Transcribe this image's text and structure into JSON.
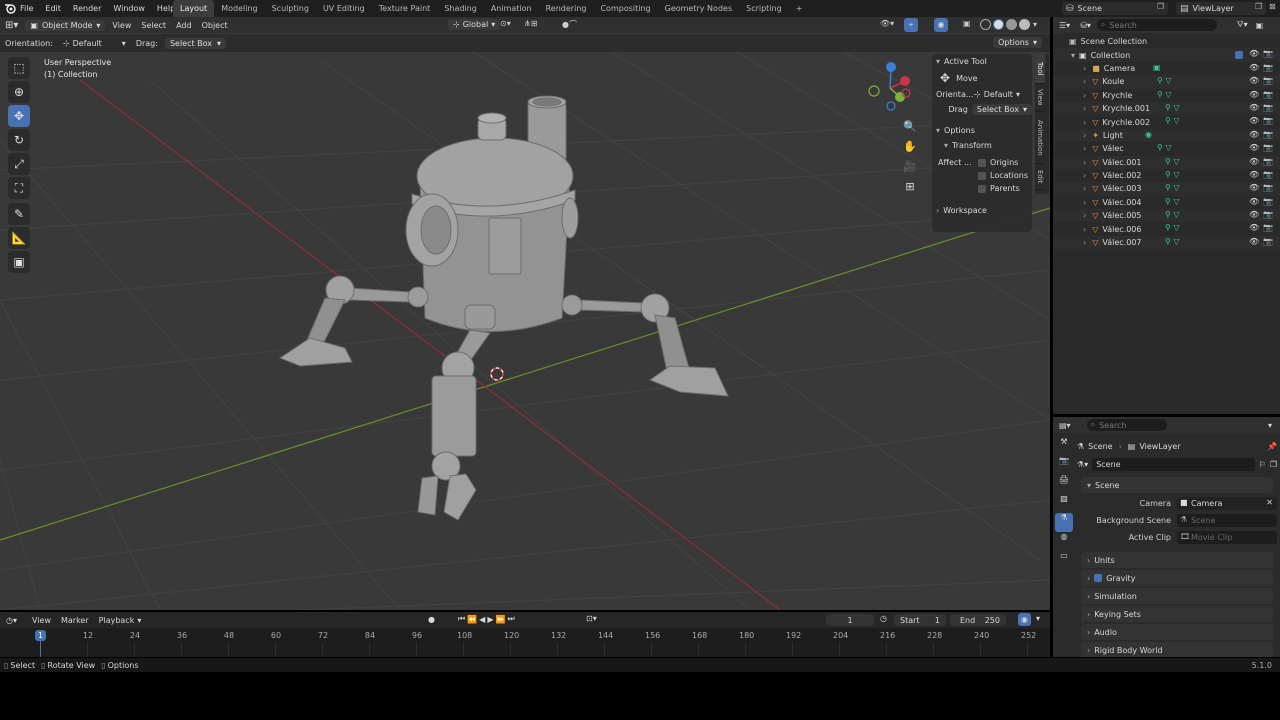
{
  "topbar": {
    "menus": [
      "File",
      "Edit",
      "Render",
      "Window",
      "Help"
    ],
    "workspaces": [
      "Layout",
      "Modeling",
      "Sculpting",
      "UV Editing",
      "Texture Paint",
      "Shading",
      "Animation",
      "Rendering",
      "Compositing",
      "Geometry Nodes",
      "Scripting"
    ],
    "active_workspace": "Layout",
    "add_tab": "+",
    "scene": "Scene",
    "view_layer": "ViewLayer"
  },
  "viewport": {
    "mode": "Object Mode",
    "menus": [
      "View",
      "Select",
      "Add",
      "Object"
    ],
    "transform_orientation": "Global",
    "orientation_label": "Orientation:",
    "orientation_value": "Default",
    "drag_label": "Drag:",
    "drag_value": "Select Box",
    "options": "Options",
    "perspective": "User Perspective",
    "collection_info": "(1) Collection"
  },
  "npanel": {
    "active_tool_title": "Active Tool",
    "tool_name": "Move",
    "orientation_label": "Orienta...",
    "orientation_value": "Default",
    "drag_label": "Drag",
    "drag_value": "Select Box",
    "options_title": "Options",
    "transform_title": "Transform",
    "affect_label": "Affect ...",
    "affect_options": [
      "Origins",
      "Locations",
      "Parents"
    ],
    "workspace_title": "Workspace",
    "tabs": [
      "Tool",
      "View",
      "Animation",
      "Edit"
    ]
  },
  "outliner": {
    "search_placeholder": "Search",
    "scene_collection": "Scene Collection",
    "collection": "Collection",
    "items": [
      {
        "name": "Camera",
        "icon": "camera-icon",
        "color": "#d6a35a"
      },
      {
        "name": "Koule",
        "icon": "mesh-icon",
        "color": "#e8943a"
      },
      {
        "name": "Krychle",
        "icon": "mesh-icon",
        "color": "#e8943a"
      },
      {
        "name": "Krychle.001",
        "icon": "mesh-icon",
        "color": "#e8943a"
      },
      {
        "name": "Krychle.002",
        "icon": "mesh-icon",
        "color": "#e8943a"
      },
      {
        "name": "Light",
        "icon": "light-icon",
        "color": "#e8943a"
      },
      {
        "name": "Válec",
        "icon": "mesh-icon",
        "color": "#e8943a"
      },
      {
        "name": "Válec.001",
        "icon": "mesh-icon",
        "color": "#e8943a"
      },
      {
        "name": "Válec.002",
        "icon": "mesh-icon",
        "color": "#e8943a"
      },
      {
        "name": "Válec.003",
        "icon": "mesh-icon",
        "color": "#e8943a"
      },
      {
        "name": "Válec.004",
        "icon": "mesh-icon",
        "color": "#e8943a"
      },
      {
        "name": "Válec.005",
        "icon": "mesh-icon",
        "color": "#e8943a"
      },
      {
        "name": "Válec.006",
        "icon": "mesh-icon",
        "color": "#e8943a"
      },
      {
        "name": "Válec.007",
        "icon": "mesh-icon",
        "color": "#e8943a"
      }
    ]
  },
  "properties": {
    "search_placeholder": "Search",
    "breadcrumb_scene": "Scene",
    "breadcrumb_layer": "ViewLayer",
    "datablock": "Scene",
    "panel_scene": "Scene",
    "camera_label": "Camera",
    "camera_value": "Camera",
    "background_label": "Background Scene",
    "background_placeholder": "Scene",
    "clip_label": "Active Clip",
    "clip_placeholder": "Movie Clip",
    "panels": [
      "Units",
      "Gravity",
      "Simulation",
      "Keying Sets",
      "Audio",
      "Rigid Body World"
    ]
  },
  "timeline": {
    "menus": [
      "View",
      "Marker",
      "Playback"
    ],
    "current_frame": "1",
    "start_label": "Start",
    "start_value": "1",
    "end_label": "End",
    "end_value": "250",
    "ticks": [
      "1",
      "12",
      "24",
      "36",
      "48",
      "60",
      "72",
      "84",
      "96",
      "108",
      "120",
      "132",
      "144",
      "156",
      "168",
      "180",
      "192",
      "204",
      "216",
      "228",
      "240",
      "252"
    ]
  },
  "statusbar": {
    "select": "Select",
    "rotate": "Rotate View",
    "options": "Options",
    "version": "5.1.0"
  },
  "colors": {
    "accent": "#4772b3",
    "orange": "#e8943a",
    "green_mesh": "#38c99a",
    "x_axis": "#c8364a",
    "y_axis": "#7bb33a",
    "z_axis": "#3a7ed6"
  }
}
